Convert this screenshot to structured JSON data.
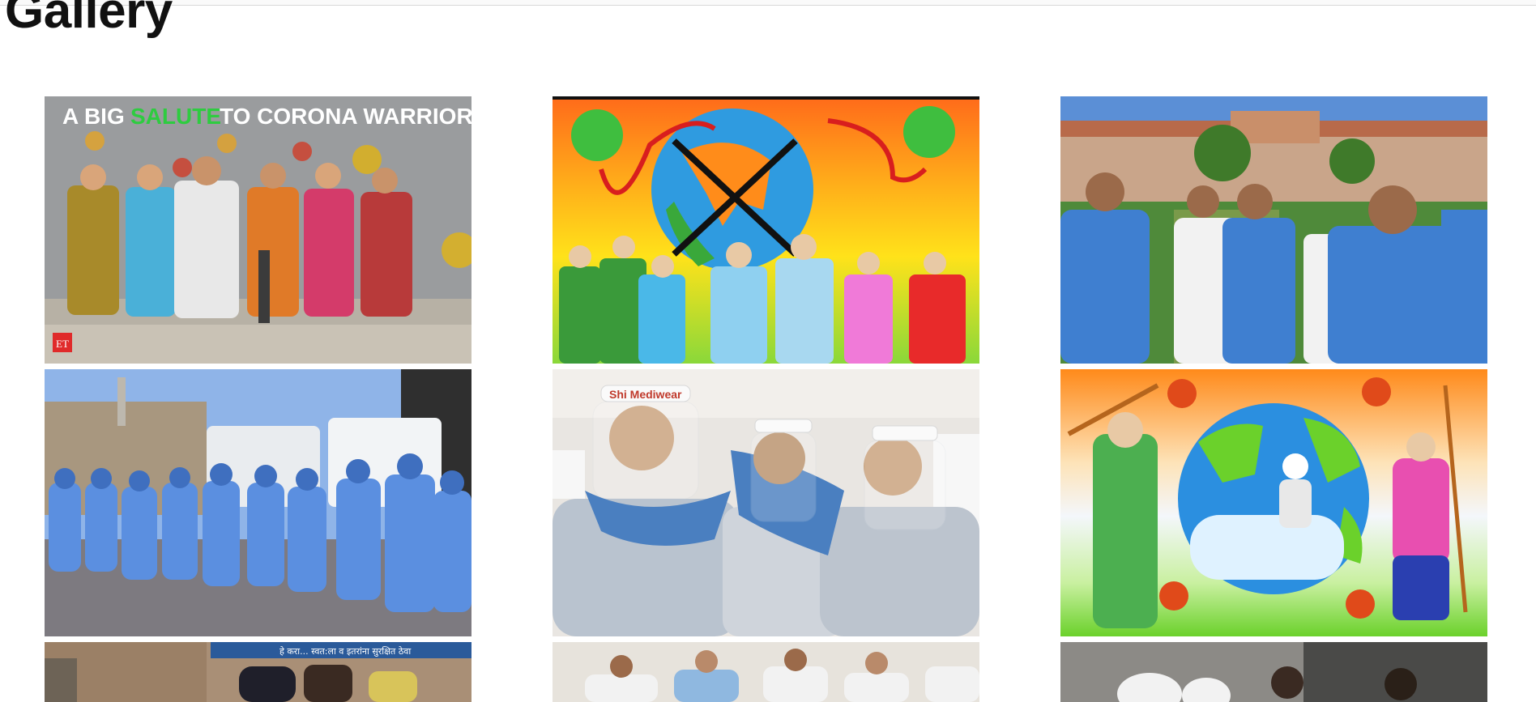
{
  "page": {
    "title": "Gallery"
  },
  "gallery": {
    "items": [
      {
        "subject": "mural-salute-corona-warriors",
        "caption_lines": [
          "A BIG",
          "SALUTE",
          "TO CORONA WARRIORS"
        ],
        "corner_badge": "ET",
        "colors": {
          "bg": "#8a8d8f",
          "ground": "#c9c2b5",
          "accent": "#2ecc40"
        }
      },
      {
        "subject": "painting-globe-chained-warriors",
        "colors": {
          "sky_top": "#ff7a1a",
          "sky_mid": "#ffd21a",
          "sky_low": "#9ae03a",
          "globe": "#2f9be0"
        }
      },
      {
        "subject": "photo-nurses-thumbs-up-hospital",
        "colors": {
          "sky": "#5b8fd6",
          "building": "#c98f6a",
          "scrubs": "#3f7fd0",
          "lawn": "#4f8a3a"
        }
      },
      {
        "subject": "photo-workers-ppe-ambulances",
        "colors": {
          "sky": "#8fb4e8",
          "ppe": "#5b8fe0",
          "road": "#7d7a80",
          "van": "#e9ecef"
        }
      },
      {
        "subject": "photo-doctors-face-shields",
        "face_shield_text": "Shi Mediwear",
        "colors": {
          "wall": "#e9e6e2",
          "gown": "#b9c3cf",
          "scarf": "#4a7fc0"
        }
      },
      {
        "subject": "painting-globe-police-sweeper",
        "colors": {
          "orange": "#ff8a1a",
          "white": "#f4f7fb",
          "green": "#6bd12b",
          "globe": "#2b8fe0"
        }
      },
      {
        "subject": "photo-police-street-banner",
        "banner_text": "हे करा... स्वत:ला व इतरांना सुरक्षित ठेवा",
        "colors": {
          "wall": "#a98f76",
          "banner": "#2a5a9a"
        }
      },
      {
        "subject": "photo-doctors-group-masks",
        "colors": {
          "bg": "#e7e3dc"
        }
      },
      {
        "subject": "photo-ppe-workers-dark",
        "colors": {
          "bg": "#6a6a68"
        }
      }
    ]
  }
}
